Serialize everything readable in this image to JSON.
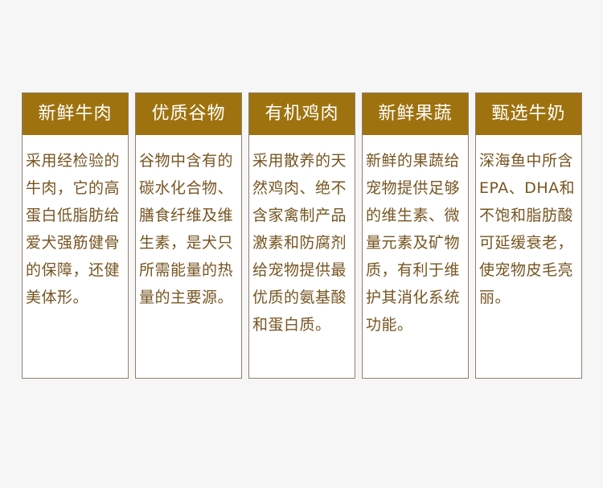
{
  "cards": [
    {
      "title": "新鲜牛肉",
      "body": "采用经检验的牛肉，它的高蛋白低脂肪给爱犬强筋健骨的保障，还健美体形。"
    },
    {
      "title": "优质谷物",
      "body": "谷物中含有的碳水化合物、膳食纤维及维生素，是犬只所需能量的热量的主要源。"
    },
    {
      "title": "有机鸡肉",
      "body": "采用散养的天然鸡肉、绝不含家禽制产品激素和防腐剂给宠物提供最优质的氨基酸和蛋白质。"
    },
    {
      "title": "新鲜果蔬",
      "body": "新鲜的果蔬给宠物提供足够的维生素、微量元素及矿物质，有利于维护其消化系统功能。"
    },
    {
      "title": "甄选牛奶",
      "body": "深海鱼中所含EPA、DHA和不饱和脂肪酸可延缓衰老，使宠物皮毛亮丽。"
    }
  ]
}
